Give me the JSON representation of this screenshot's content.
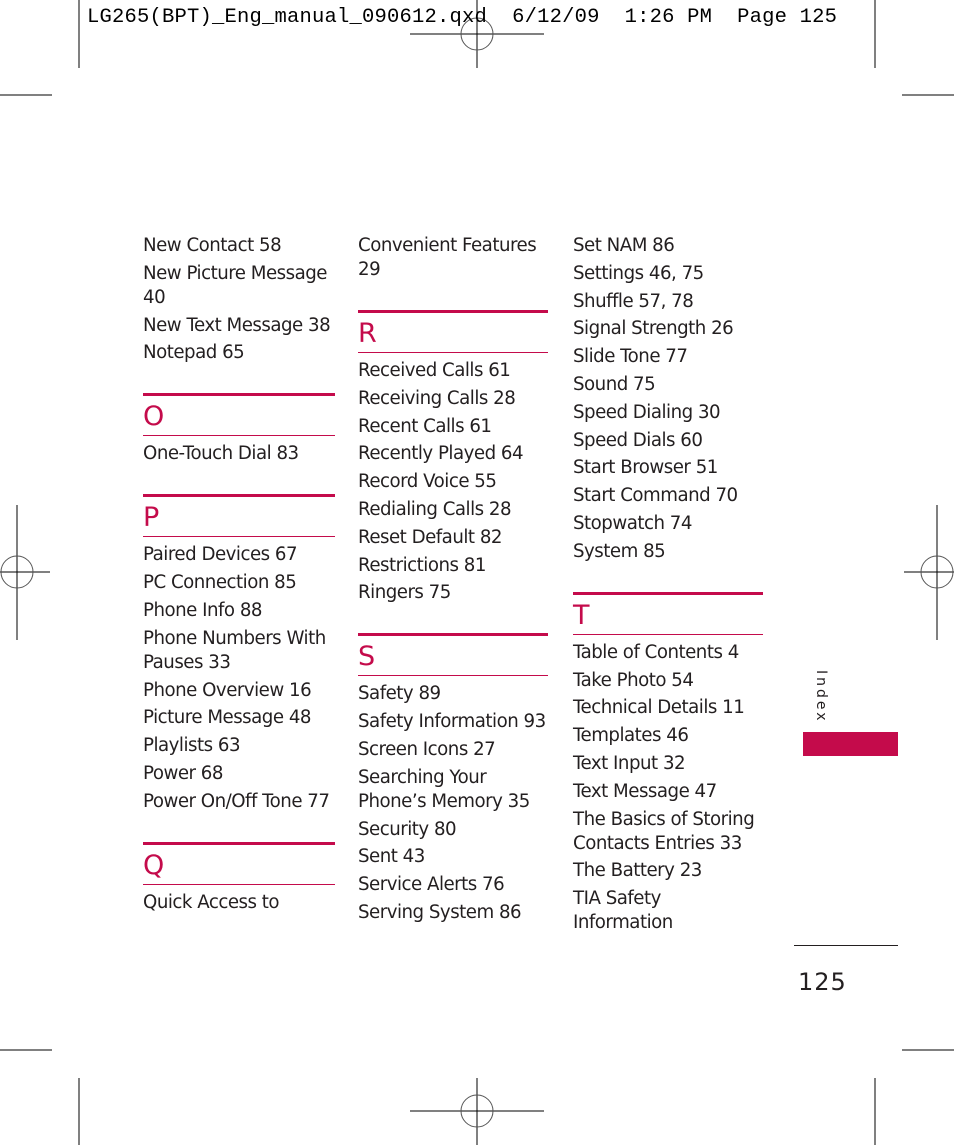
{
  "print_slug": "LG265(BPT)_Eng_manual_090612.qxd  6/12/09  1:26 PM  Page 125",
  "side_tab": {
    "label": "Index",
    "color": "#c40b4b"
  },
  "page_number": "125",
  "accent_color": "#c40b4b",
  "columns": [
    {
      "blocks": [
        {
          "letter": null,
          "entries": [
            "New Contact 58",
            "New Picture Message 40",
            "New Text Message 38",
            "Notepad 65"
          ]
        },
        {
          "letter": "O",
          "entries": [
            "One-Touch Dial 83"
          ]
        },
        {
          "letter": "P",
          "entries": [
            "Paired Devices 67",
            "PC Connection 85",
            "Phone Info 88",
            "Phone Numbers With Pauses 33",
            "Phone Overview 16",
            "Picture Message 48",
            "Playlists 63",
            "Power 68",
            "Power On/Off Tone 77"
          ]
        },
        {
          "letter": "Q",
          "entries": [
            "Quick Access to"
          ]
        }
      ]
    },
    {
      "blocks": [
        {
          "letter": null,
          "entries": [
            "Convenient Features 29"
          ]
        },
        {
          "letter": "R",
          "entries": [
            "Received Calls 61",
            "Receiving Calls 28",
            "Recent Calls 61",
            "Recently Played 64",
            "Record Voice 55",
            "Redialing Calls 28",
            "Reset Default 82",
            "Restrictions 81",
            "Ringers 75"
          ]
        },
        {
          "letter": "S",
          "entries": [
            "Safety 89",
            "Safety Information 93",
            "Screen Icons 27",
            "Searching Your Phone’s Memory 35",
            "Security 80",
            "Sent 43",
            "Service Alerts 76",
            "Serving System 86"
          ]
        }
      ]
    },
    {
      "blocks": [
        {
          "letter": null,
          "entries": [
            "Set NAM 86",
            "Settings 46, 75",
            "Shuffle 57, 78",
            "Signal Strength 26",
            "Slide Tone 77",
            "Sound 75",
            "Speed Dialing 30",
            "Speed Dials 60",
            "Start Browser 51",
            "Start Command 70",
            "Stopwatch 74",
            "System 85"
          ]
        },
        {
          "letter": "T",
          "entries": [
            "Table of Contents 4",
            "Take Photo 54",
            "Technical Details 11",
            "Templates 46",
            "Text Input 32",
            "Text Message 47",
            "The Basics of Storing Contacts Entries 33",
            "The Battery 23",
            "TIA Safety Information"
          ]
        }
      ]
    }
  ]
}
